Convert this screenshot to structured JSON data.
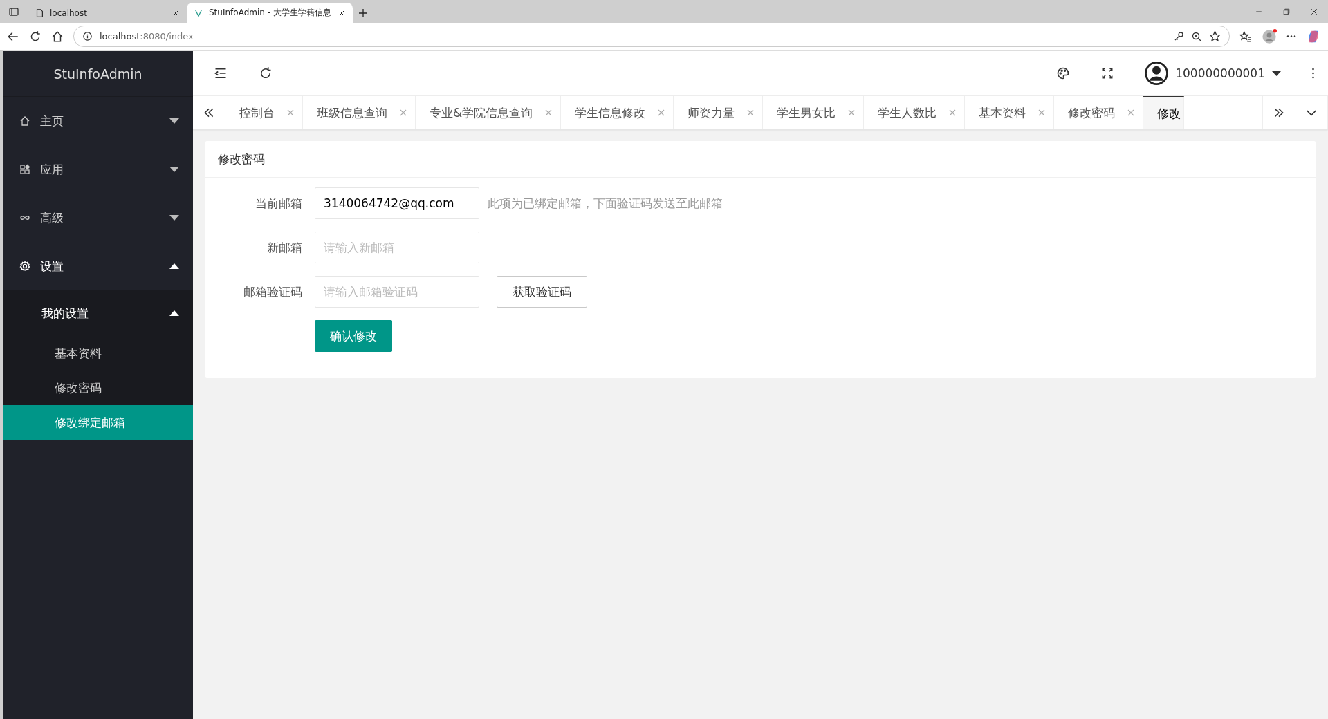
{
  "browser": {
    "tabs": [
      {
        "title": "localhost",
        "selected": false
      },
      {
        "title": "StuInfoAdmin - 大学生学籍信息",
        "selected": true
      }
    ],
    "address": {
      "host": "localhost",
      "rest": ":8080/index"
    }
  },
  "sidebar": {
    "logo": "StuInfoAdmin",
    "items": [
      {
        "label": "主页",
        "expanded": false
      },
      {
        "label": "应用",
        "expanded": false
      },
      {
        "label": "高级",
        "expanded": false
      },
      {
        "label": "设置",
        "expanded": true,
        "children": [
          {
            "label": "我的设置",
            "expanded": true,
            "children": [
              {
                "label": "基本资料",
                "selected": false
              },
              {
                "label": "修改密码",
                "selected": false
              },
              {
                "label": "修改绑定邮箱",
                "selected": true
              }
            ]
          }
        ]
      }
    ]
  },
  "header": {
    "user": "100000000001"
  },
  "tabs": [
    {
      "label": "控制台",
      "selected": false
    },
    {
      "label": "班级信息查询",
      "selected": false
    },
    {
      "label": "专业&学院信息查询",
      "selected": false
    },
    {
      "label": "学生信息修改",
      "selected": false
    },
    {
      "label": "师资力量",
      "selected": false
    },
    {
      "label": "学生男女比",
      "selected": false
    },
    {
      "label": "学生人数比",
      "selected": false
    },
    {
      "label": "基本资料",
      "selected": false
    },
    {
      "label": "修改密码",
      "selected": false
    },
    {
      "label": "修改",
      "selected": true
    }
  ],
  "card": {
    "title": "修改密码",
    "fields": [
      {
        "label": "当前邮箱",
        "value": "3140064742@qq.com",
        "hint": "此项为已绑定邮箱，下面验证码发送至此邮箱"
      },
      {
        "label": "新邮箱",
        "placeholder": "请输入新邮箱"
      },
      {
        "label": "邮箱验证码",
        "placeholder": "请输入邮箱验证码",
        "button": "获取验证码"
      }
    ],
    "submit": "确认修改"
  }
}
